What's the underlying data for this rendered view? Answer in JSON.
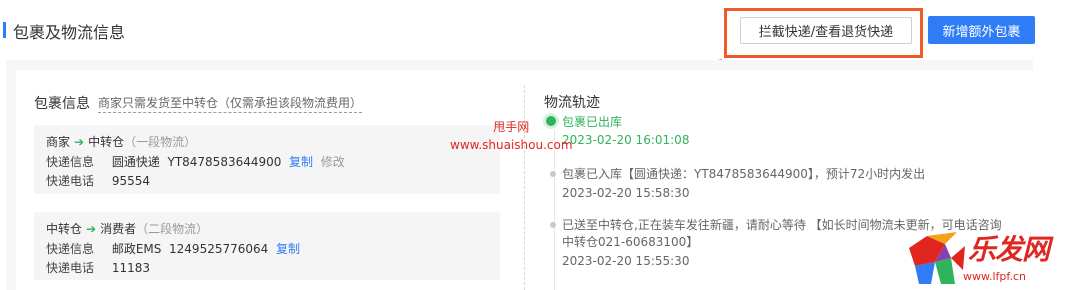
{
  "header": {
    "title": "包裹及物流信息",
    "intercept_button": "拦截快递/查看退货快递",
    "add_package_button": "新增额外包裹"
  },
  "package_info": {
    "title": "包裹信息",
    "hint": "商家只需发货至中转仓（仅需承担该段物流费用）",
    "legs": [
      {
        "from": "商家",
        "to": "中转仓",
        "segment": "（一段物流）",
        "express_label": "快递信息",
        "carrier": "圆通快递",
        "tracking_no": "YT8478583644900",
        "copy": "复制",
        "edit": "修改",
        "phone_label": "快递电话",
        "phone": "95554"
      },
      {
        "from": "中转仓",
        "to": "消费者",
        "segment": "（二段物流）",
        "express_label": "快递信息",
        "carrier": "邮政EMS",
        "tracking_no": "1249525776064",
        "copy": "复制",
        "phone_label": "快递电话",
        "phone": "11183"
      }
    ]
  },
  "logistics": {
    "title": "物流轨迹",
    "events": [
      {
        "status": "包裹已出库",
        "time": "2023-02-20 16:01:08"
      },
      {
        "status": "包裹已入库【圆通快递：YT8478583644900】，预计72小时内发出",
        "time": "2023-02-20 15:58:30"
      },
      {
        "status": "已送至中转仓,正在装车发往新疆，请耐心等待 【如长时间物流未更新，可电话咨询",
        "status_line2": "中转仓021-60683100】",
        "time": "2023-02-20 15:55:30"
      }
    ]
  },
  "watermark": {
    "line1": "甩手网",
    "line2": "www.shuaishou.com"
  },
  "logo": {
    "text": "乐发网",
    "url": "www.lfpf.cn"
  },
  "colors": {
    "accent": "#2f7cf6",
    "success": "#2fb45c",
    "highlight": "#ef5a28"
  }
}
